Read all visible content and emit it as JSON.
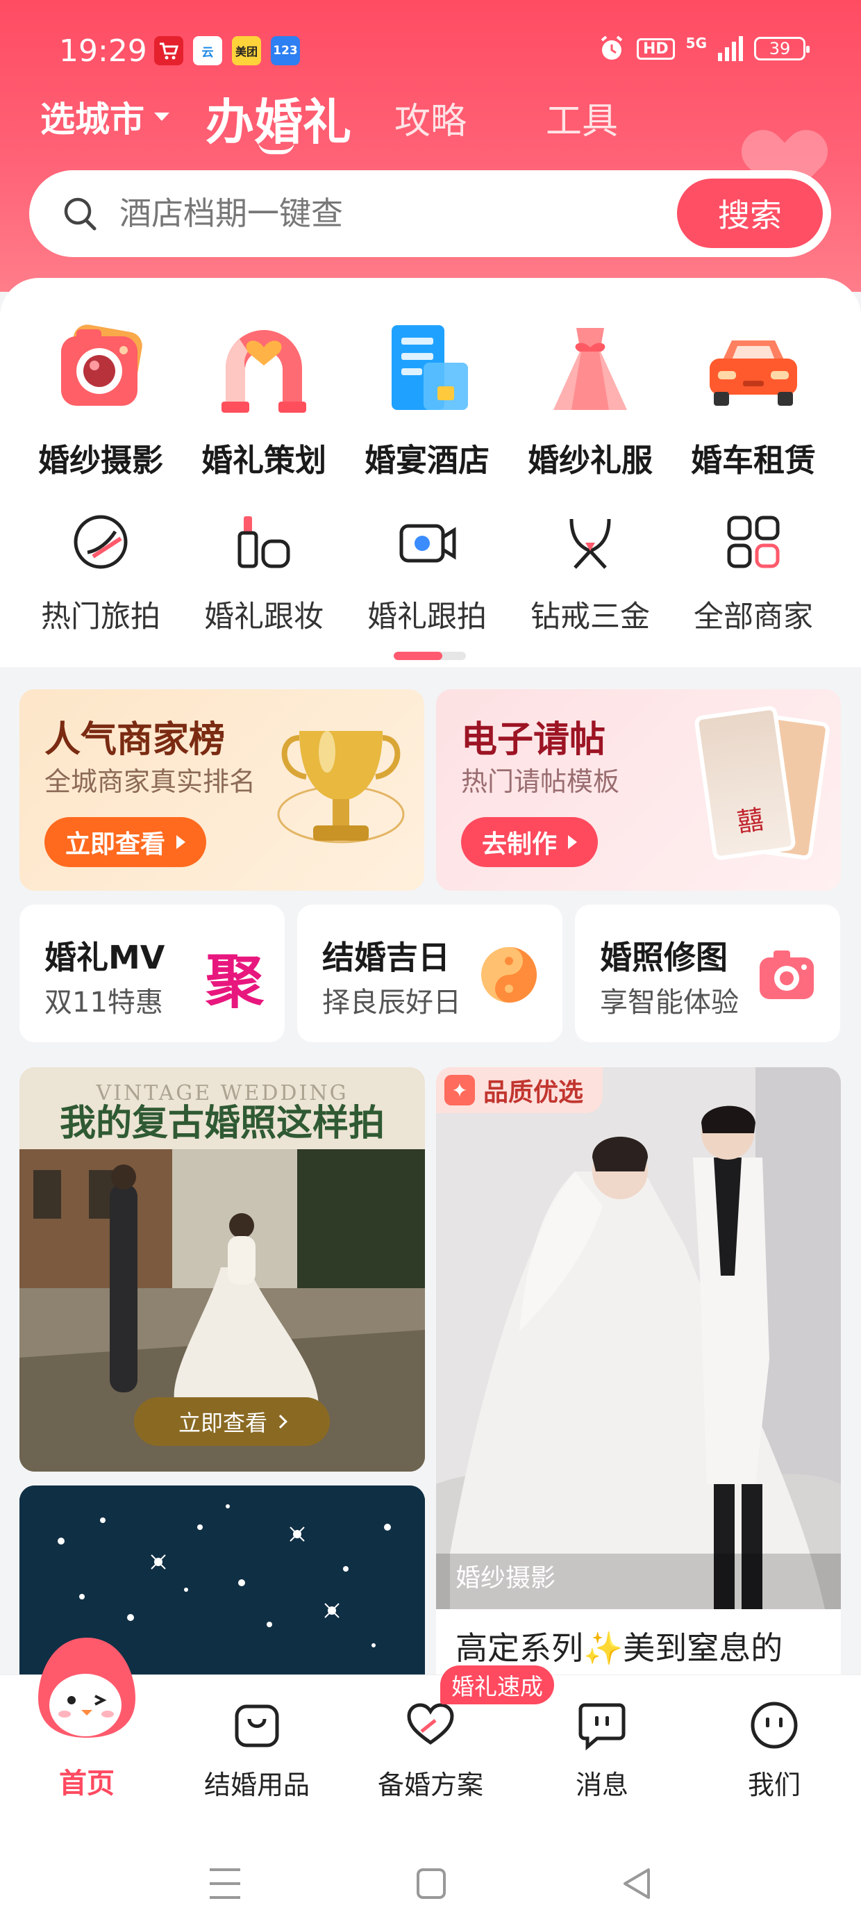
{
  "status_bar": {
    "time": "19:29",
    "apps": [
      "taobao-icon",
      "cloud-icon",
      "美团",
      "123"
    ],
    "hd": "HD",
    "network": "5G",
    "battery": "39"
  },
  "nav": {
    "city": "选城市",
    "tabs": [
      {
        "label": "办婚礼",
        "active": true
      },
      {
        "label": "攻略",
        "active": false
      },
      {
        "label": "工具",
        "active": false
      }
    ]
  },
  "search": {
    "placeholder": "酒店档期一键查",
    "button": "搜索"
  },
  "categories_primary": [
    {
      "label": "婚纱摄影",
      "icon": "camera-icon"
    },
    {
      "label": "婚礼策划",
      "icon": "wedding-arch-icon"
    },
    {
      "label": "婚宴酒店",
      "icon": "hotel-icon"
    },
    {
      "label": "婚纱礼服",
      "icon": "dress-icon"
    },
    {
      "label": "婚车租赁",
      "icon": "car-icon"
    }
  ],
  "categories_secondary": [
    {
      "label": "热门旅拍",
      "icon": "travel-photo-icon"
    },
    {
      "label": "婚礼跟妆",
      "icon": "makeup-icon"
    },
    {
      "label": "婚礼跟拍",
      "icon": "video-camera-icon"
    },
    {
      "label": "钻戒三金",
      "icon": "necklace-icon"
    },
    {
      "label": "全部商家",
      "icon": "grid-icon"
    }
  ],
  "promos": [
    {
      "title": "人气商家榜",
      "subtitle": "全城商家真实排名",
      "button": "立即查看",
      "icon": "trophy-icon"
    },
    {
      "title": "电子请帖",
      "subtitle": "热门请帖模板",
      "button": "去制作",
      "icon": "invitation-card-icon",
      "card_text": "囍"
    }
  ],
  "quick_cards": [
    {
      "title": "婚礼MV",
      "subtitle": "双11特惠",
      "glyph": "聚",
      "icon": "ju-icon"
    },
    {
      "title": "结婚吉日",
      "subtitle": "择良辰好日",
      "icon": "yin-yang-icon"
    },
    {
      "title": "婚照修图",
      "subtitle": "享智能体验",
      "icon": "camera-icon"
    }
  ],
  "feed": {
    "left_card": {
      "title": "我的复古婚照这样拍",
      "watermark": "VINTAGE WEDDING",
      "button": "立即查看"
    },
    "right_card": {
      "badge": "品质优选",
      "tag": "婚纱摄影",
      "text": "高定系列✨美到窒息的"
    }
  },
  "bottom_nav": [
    {
      "label": "首页",
      "active": true
    },
    {
      "label": "结婚用品",
      "active": false
    },
    {
      "label": "备婚方案",
      "active": false,
      "badge": "婚礼速成"
    },
    {
      "label": "消息",
      "active": false
    },
    {
      "label": "我们",
      "active": false
    }
  ],
  "colors": {
    "accent": "#ff4c63",
    "header_gradient_end": "#ff7d8a",
    "promo_orange": "#ff6a1f",
    "promo_red": "#ff4a5e"
  }
}
